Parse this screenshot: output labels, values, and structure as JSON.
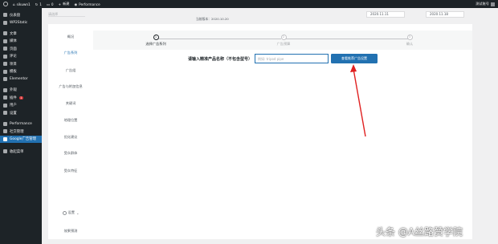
{
  "adminbar": {
    "site": "sikuwn1",
    "comments": "1",
    "updates": "0",
    "new_label": "新建",
    "performance": "Performance",
    "howdy": "测试账号"
  },
  "sidemenu": {
    "items": [
      {
        "label": "仪表盘",
        "icon": "dashboard-icon"
      },
      {
        "label": "WP2Static",
        "icon": "plugin-icon"
      },
      {
        "label": "文章",
        "icon": "pin-icon"
      },
      {
        "label": "媒体",
        "icon": "media-icon"
      },
      {
        "label": "页面",
        "icon": "page-icon"
      },
      {
        "label": "评论",
        "icon": "comment-icon"
      },
      {
        "label": "项目",
        "icon": "portfolio-icon"
      },
      {
        "label": "模板",
        "icon": "template-icon"
      },
      {
        "label": "Elementor",
        "icon": "elementor-icon"
      },
      {
        "label": "外观",
        "icon": "brush-icon"
      },
      {
        "label": "插件",
        "icon": "plugin-icon",
        "badge": "1"
      },
      {
        "label": "用户",
        "icon": "user-icon"
      },
      {
        "label": "设置",
        "icon": "settings-icon"
      },
      {
        "label": "Performance",
        "icon": "performance-icon"
      },
      {
        "label": "社交管理",
        "icon": "social-icon"
      },
      {
        "label": "Google广告管理",
        "icon": "google-icon",
        "active": true
      }
    ],
    "collapse_label": "收起菜单"
  },
  "filterbar": {
    "select_placeholder": "请选择",
    "version": "当前版本：2020.10.20",
    "start_date": "2020.11.11",
    "end_date": "2020.11.18",
    "separator": "~"
  },
  "subnav": {
    "items": [
      "概况",
      "广告系列",
      "广告组",
      "广告与附加信息",
      "关键词",
      "地理位置",
      "优化建议",
      "受众群体",
      "受众特征"
    ],
    "active_index": 1,
    "settings_label": "设置",
    "bottom_label": "效果预测"
  },
  "steps": [
    {
      "number": "1",
      "label": "选择广告系列"
    },
    {
      "number": "2",
      "label": "广告预算"
    },
    {
      "number": "3",
      "label": "确认"
    }
  ],
  "form": {
    "label": "请输入精准产品名称（不包含型号）",
    "input_placeholder": "例如: tripod pipe",
    "button_label": "查看推荐广告设置"
  },
  "watermark": "头条 @A丝路赞学院"
}
